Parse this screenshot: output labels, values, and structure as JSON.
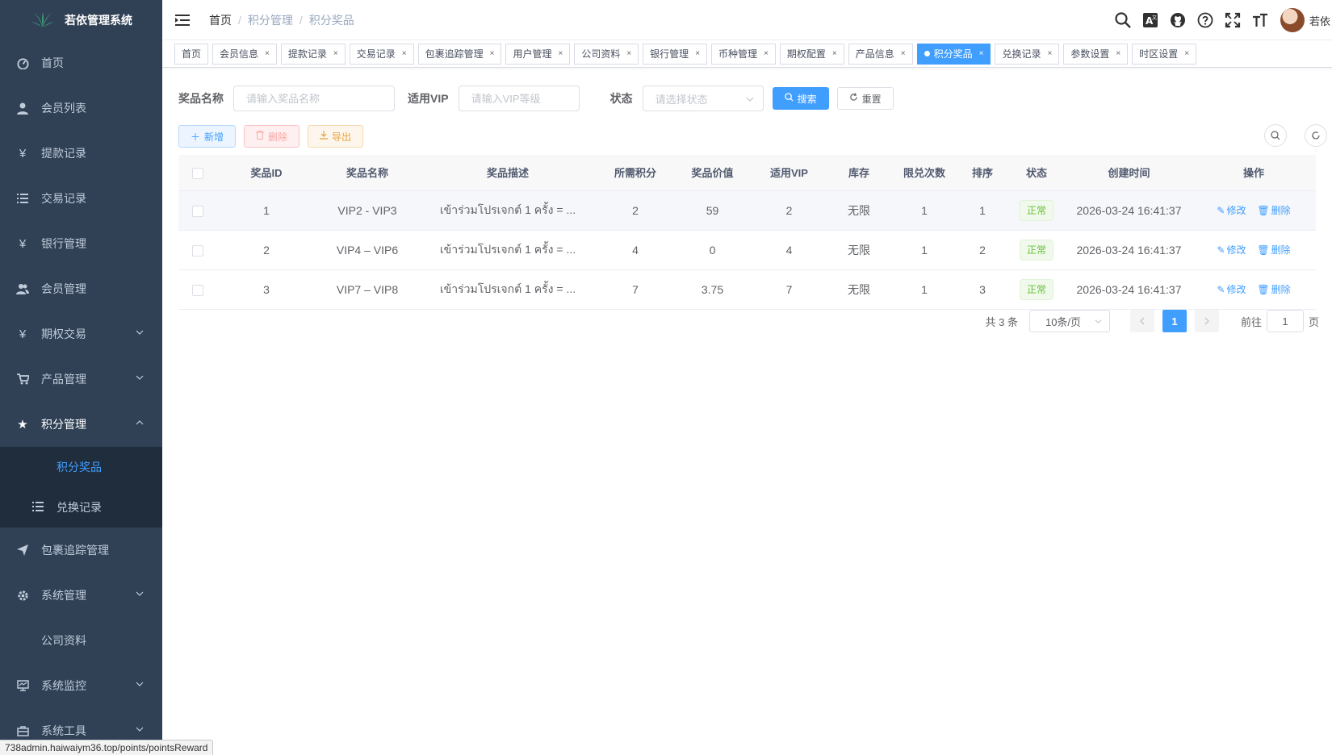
{
  "app": {
    "title": "若依管理系统"
  },
  "sidebar": {
    "items": [
      {
        "label": "首页",
        "icon": "dashboard-icon"
      },
      {
        "label": "会员列表",
        "icon": "user-icon"
      },
      {
        "label": "提款记录",
        "icon": "yen-icon"
      },
      {
        "label": "交易记录",
        "icon": "list-icon"
      },
      {
        "label": "银行管理",
        "icon": "yen-icon"
      },
      {
        "label": "会员管理",
        "icon": "peoples-icon"
      },
      {
        "label": "期权交易",
        "icon": "yen-icon"
      },
      {
        "label": "产品管理",
        "icon": "cart-icon"
      },
      {
        "label": "积分管理",
        "icon": "star-icon"
      },
      {
        "label": "包裹追踪管理",
        "icon": "send-icon"
      },
      {
        "label": "系统管理",
        "icon": "gear-icon"
      },
      {
        "label": "公司资料"
      },
      {
        "label": "系统监控",
        "icon": "monitor-icon"
      },
      {
        "label": "系统工具",
        "icon": "toolbox-icon"
      }
    ],
    "sub_items": [
      {
        "label": "积分奖品"
      },
      {
        "label": "兑换记录"
      }
    ]
  },
  "breadcrumb": [
    "首页",
    "积分管理",
    "积分奖品"
  ],
  "user": {
    "name": "若依"
  },
  "tabs": [
    {
      "label": "首页"
    },
    {
      "label": "会员信息"
    },
    {
      "label": "提款记录"
    },
    {
      "label": "交易记录"
    },
    {
      "label": "包裹追踪管理"
    },
    {
      "label": "用户管理"
    },
    {
      "label": "公司资料"
    },
    {
      "label": "银行管理"
    },
    {
      "label": "币种管理"
    },
    {
      "label": "期权配置"
    },
    {
      "label": "产品信息"
    },
    {
      "label": "积分奖品"
    },
    {
      "label": "兑换记录"
    },
    {
      "label": "参数设置"
    },
    {
      "label": "时区设置"
    }
  ],
  "search": {
    "name_label": "奖品名称",
    "name_placeholder": "请输入奖品名称",
    "vip_label": "适用VIP",
    "vip_placeholder": "请输入VIP等级",
    "status_label": "状态",
    "status_placeholder": "请选择状态",
    "search_btn": "搜索",
    "reset_btn": "重置"
  },
  "toolbar": {
    "add": "新增",
    "delete": "删除",
    "export": "导出"
  },
  "table": {
    "headers": [
      "奖品ID",
      "奖品名称",
      "奖品描述",
      "所需积分",
      "奖品价值",
      "适用VIP",
      "库存",
      "限兑次数",
      "排序",
      "状态",
      "创建时间",
      "操作"
    ],
    "rows": [
      {
        "id": "1",
        "name": "VIP2 - VIP3",
        "desc": "เข้าร่วมโปรเจกต์ 1 ครั้ง = ...",
        "points": "2",
        "value": "59",
        "vip": "2",
        "stock": "无限",
        "limit": "1",
        "sort": "1",
        "status": "正常",
        "created": "2026-03-24 16:41:37"
      },
      {
        "id": "2",
        "name": "VIP4 – VIP6",
        "desc": "เข้าร่วมโปรเจกต์ 1 ครั้ง = ...",
        "points": "4",
        "value": "0",
        "vip": "4",
        "stock": "无限",
        "limit": "1",
        "sort": "2",
        "status": "正常",
        "created": "2026-03-24 16:41:37"
      },
      {
        "id": "3",
        "name": "VIP7 – VIP8",
        "desc": "เข้าร่วมโปรเจกต์ 1 ครั้ง = ...",
        "points": "7",
        "value": "3.75",
        "vip": "7",
        "stock": "无限",
        "limit": "1",
        "sort": "3",
        "status": "正常",
        "created": "2026-03-24 16:41:37"
      }
    ],
    "edit_label": "修改",
    "delete_label": "删除"
  },
  "pagination": {
    "total": "共 3 条",
    "page_size": "10条/页",
    "current": "1",
    "goto_prefix": "前往",
    "goto_value": "1",
    "goto_suffix": "页"
  },
  "status_url": "738admin.haiwaiym36.top/points/pointsReward",
  "colors": {
    "sidebar_bg": "#304156",
    "submenu_bg": "#1f2d3d",
    "primary": "#409eff",
    "success": "#67c23a"
  }
}
